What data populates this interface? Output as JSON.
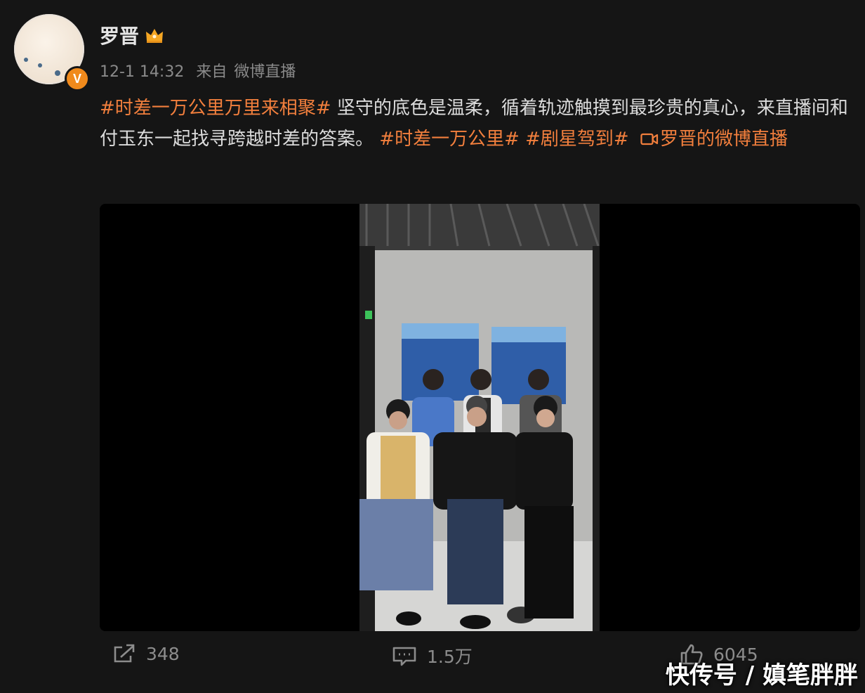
{
  "user": {
    "name": "罗晋",
    "verified_badge": "V"
  },
  "meta": {
    "time": "12-1 14:32",
    "source_prefix": "来自",
    "source": "微博直播"
  },
  "post": {
    "tag1": "#时差一万公里万里来相聚#",
    "text1": " 坚守的底色是温柔，循着轨迹触摸到最珍贵的真心，来直播间和付玉东一起找寻跨越时差的答案。",
    "tag2": "#时差一万公里#",
    "tag3": "#剧星驾到#",
    "link_icon": "live-icon",
    "link_text": "罗晋的微博直播"
  },
  "actions": {
    "repost": "348",
    "comments": "1.5万",
    "likes": "6045"
  },
  "watermark": "快传号 / 嫃笔胖胖",
  "colors": {
    "background": "#151515",
    "accent": "#f27f3d",
    "badge": "#f08a1c"
  }
}
